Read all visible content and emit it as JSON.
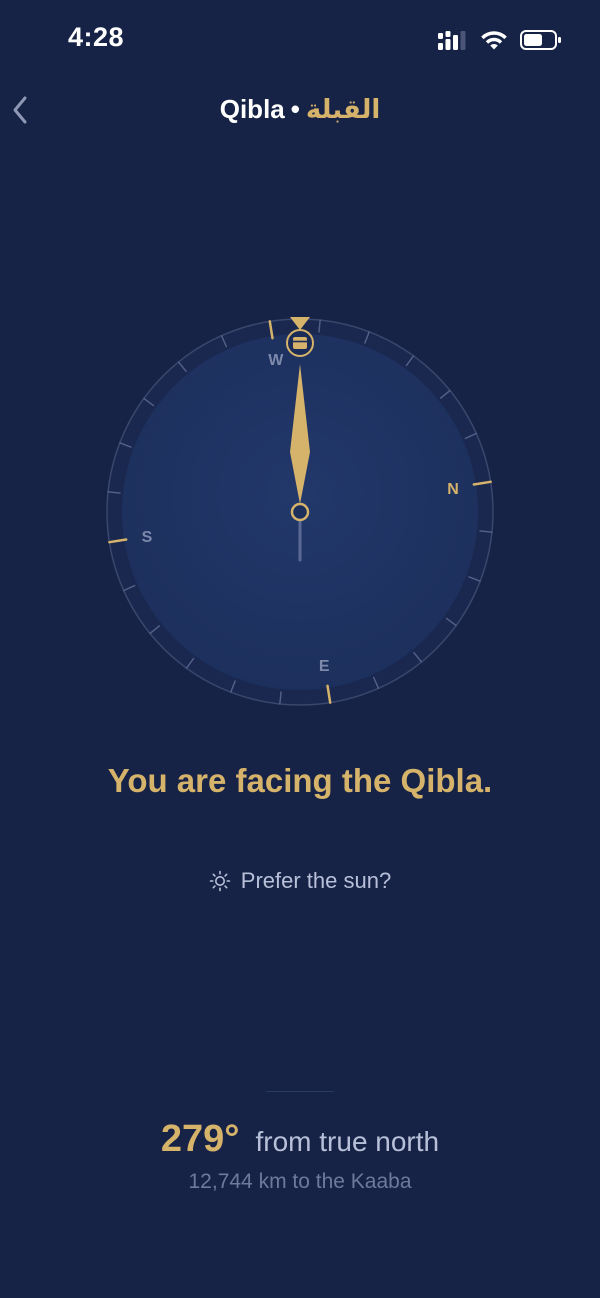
{
  "status_bar": {
    "time": "4:28",
    "icons": [
      "cellular-signal-icon",
      "wifi-icon",
      "battery-icon"
    ]
  },
  "nav": {
    "back_icon": "chevron-left-icon",
    "title_en": "Qibla",
    "separator": "•",
    "title_ar": "القبلة"
  },
  "compass": {
    "heading_deg": 279,
    "cardinals": {
      "N": "N",
      "E": "E",
      "S": "S",
      "W": "W"
    },
    "kaaba_icon": "kaaba-icon",
    "colors": {
      "gold": "#d6b36a",
      "dial": "#1f3260",
      "ring": "#1a2850",
      "tick": "#56618a"
    }
  },
  "facing_text": "You are facing the Qibla.",
  "prefer_sun": {
    "icon": "sun-icon",
    "label": "Prefer the sun?"
  },
  "bearing": {
    "value": "279°",
    "label": "from true north"
  },
  "distance": "12,744 km to the Kaaba",
  "colors": {
    "background": "#172346",
    "accent": "#d6b36a",
    "muted_text": "#b7c0d8",
    "dim_text": "#6d7a9c"
  }
}
